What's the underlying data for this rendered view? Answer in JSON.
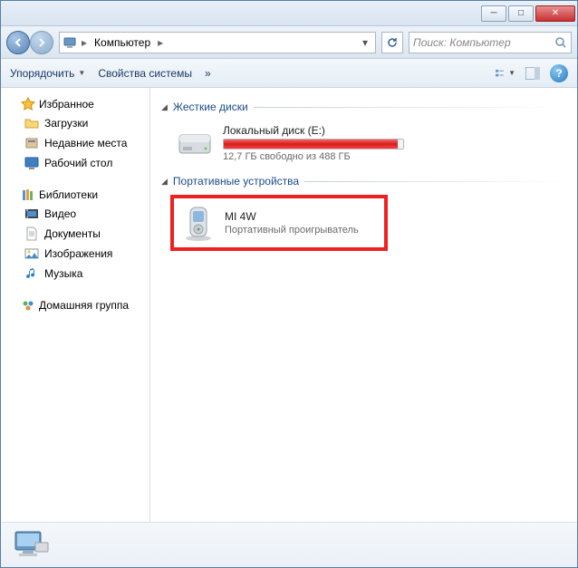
{
  "titlebar": {
    "min": "─",
    "max": "□",
    "close": "✕"
  },
  "breadcrumb": {
    "root_icon": "computer",
    "segment": "Компьютер",
    "arrow": "▸",
    "dropdown": "▾"
  },
  "search": {
    "placeholder": "Поиск: Компьютер"
  },
  "toolbar": {
    "organize": "Упорядочить",
    "system_props": "Свойства системы",
    "more": "»"
  },
  "sidebar": {
    "favorites": {
      "label": "Избранное",
      "items": [
        {
          "icon": "downloads",
          "label": "Загрузки"
        },
        {
          "icon": "recent",
          "label": "Недавние места"
        },
        {
          "icon": "desktop",
          "label": "Рабочий стол"
        }
      ]
    },
    "libraries": {
      "label": "Библиотеки",
      "items": [
        {
          "icon": "video",
          "label": "Видео"
        },
        {
          "icon": "documents",
          "label": "Документы"
        },
        {
          "icon": "pictures",
          "label": "Изображения"
        },
        {
          "icon": "music",
          "label": "Музыка"
        }
      ]
    },
    "homegroup": {
      "label": "Домашняя группа"
    }
  },
  "content": {
    "groups": [
      {
        "title": "Жесткие диски",
        "type": "drive",
        "items": [
          {
            "name": "Локальный диск (E:)",
            "free_text": "12,7 ГБ свободно из 488 ГБ",
            "fill_percent": 97
          }
        ]
      },
      {
        "title": "Портативные устройства",
        "type": "device",
        "items": [
          {
            "name": "MI 4W",
            "subtitle": "Портативный проигрыватель",
            "highlighted": true
          }
        ]
      }
    ]
  }
}
